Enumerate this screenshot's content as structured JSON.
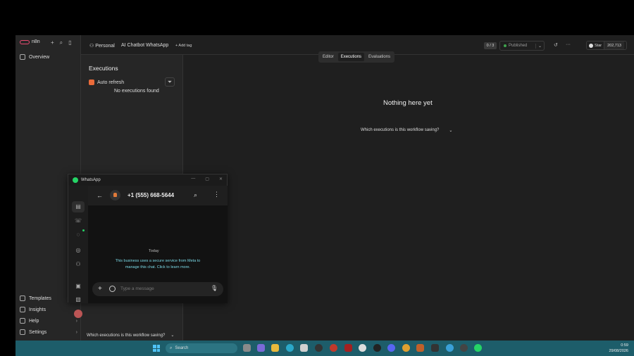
{
  "brand": {
    "name": "n8n"
  },
  "sidebar": {
    "items": [
      {
        "label": "Overview"
      },
      {
        "label": "Templates"
      },
      {
        "label": "Insights"
      },
      {
        "label": "Help"
      },
      {
        "label": "Settings"
      }
    ]
  },
  "header": {
    "project": "Personal",
    "workflow": "AI Chatbot WhatsApp",
    "add_tag": "+ Add tag",
    "counter": "0 / 3",
    "published": "Published",
    "star": "Star",
    "star_count": "202,713"
  },
  "tabs": [
    {
      "label": "Editor"
    },
    {
      "label": "Executions"
    },
    {
      "label": "Evaluations"
    }
  ],
  "executions": {
    "title": "Executions",
    "auto_refresh": "Auto refresh",
    "empty": "No executions found",
    "saving_question": "Which executions is this workflow saving?"
  },
  "main": {
    "empty_title": "Nothing here yet",
    "saving_question": "Which executions is this workflow saving?"
  },
  "whatsapp": {
    "window_title": "WhatsApp",
    "contact": "+1 (555) 668-5644",
    "today": "Today",
    "notice": "This business uses a secure service from Meta to manage this chat. Click to learn more.",
    "placeholder": "Type a message"
  },
  "taskbar": {
    "search": "Search",
    "time": "0:59",
    "date": "29/08/2026"
  },
  "colors": {
    "accent": "#ea4b71",
    "whatsapp": "#25d366",
    "taskbar": "#1d5d6a"
  }
}
